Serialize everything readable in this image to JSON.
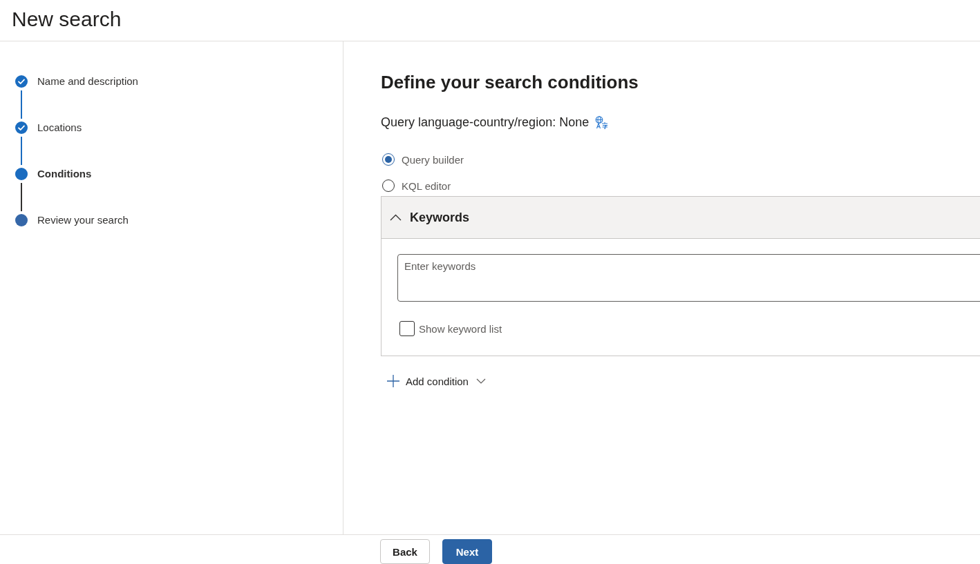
{
  "page": {
    "title": "New search"
  },
  "steps": [
    {
      "label": "Name and description",
      "completed": true,
      "selected": false
    },
    {
      "label": "Locations",
      "completed": true,
      "selected": false
    },
    {
      "label": "Conditions",
      "completed": false,
      "selected": true
    },
    {
      "label": "Review your search",
      "completed": false,
      "selected": false
    }
  ],
  "main": {
    "heading": "Define your search conditions",
    "query_language": {
      "label": "Query language-country/region: None"
    },
    "query_modes": [
      {
        "label": "Query builder",
        "selected": true
      },
      {
        "label": "KQL editor",
        "selected": false
      }
    ],
    "keywords_panel": {
      "title": "Keywords",
      "expanded": true,
      "input": {
        "placeholder": "Enter keywords"
      },
      "show_keyword_list": {
        "label": "Show keyword list",
        "checked": false
      }
    },
    "add_condition": {
      "label": "Add condition"
    }
  },
  "footer": {
    "buttons": [
      {
        "label": "Back",
        "kind": "secondary"
      },
      {
        "label": "Next",
        "kind": "primary"
      }
    ]
  }
}
